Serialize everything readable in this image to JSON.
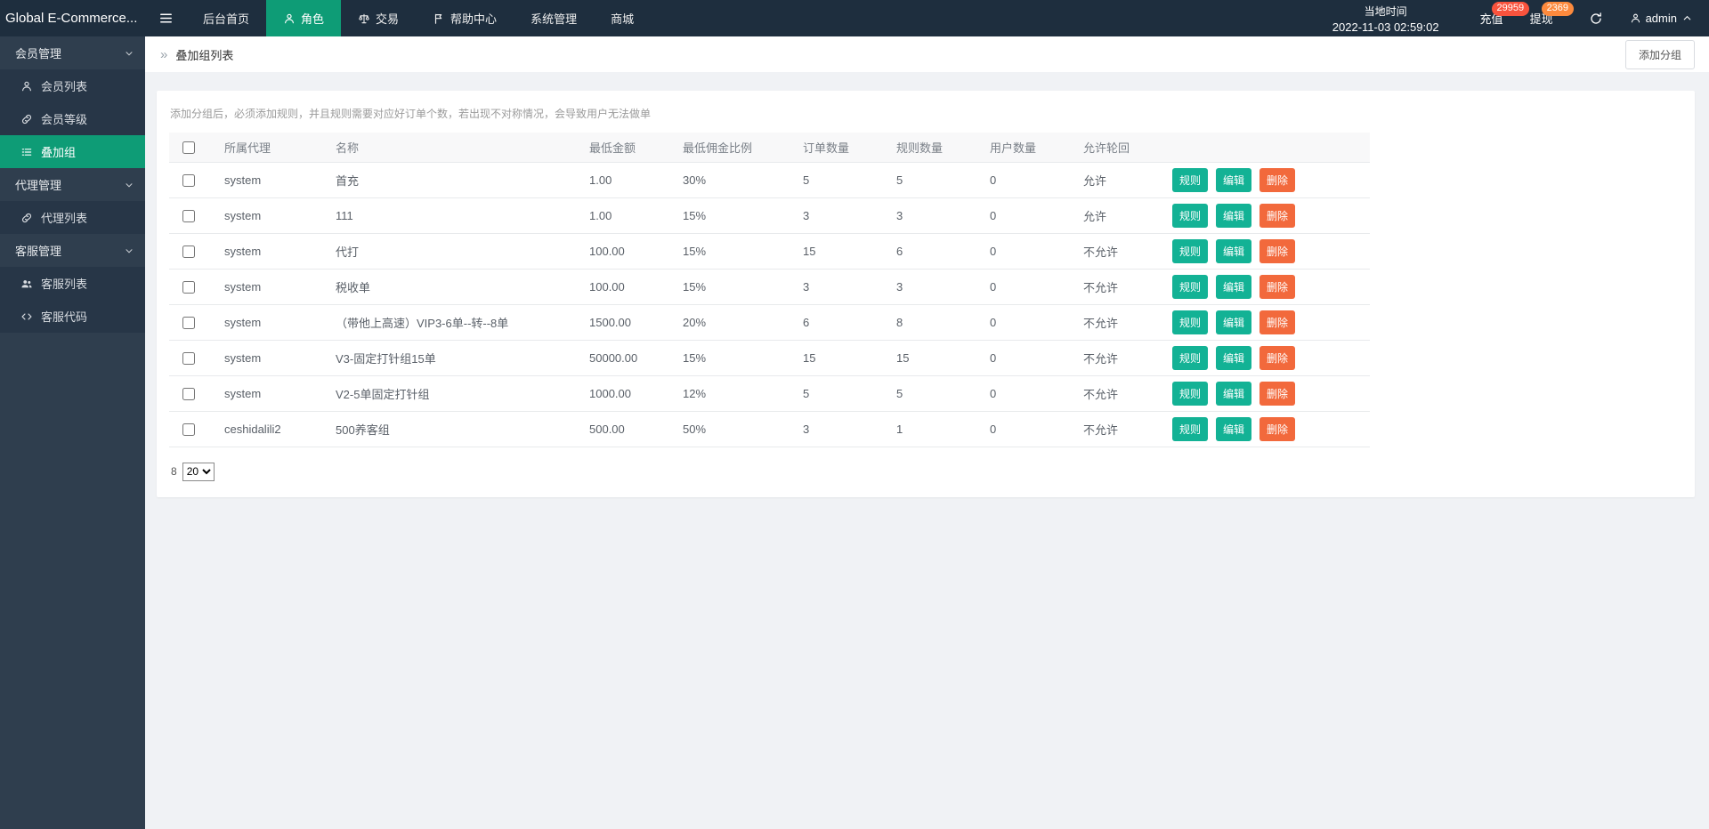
{
  "colors": {
    "topbar_bg": "#1e2e3e",
    "sidebar_bg": "#2f3e4e",
    "sidebar_item_bg": "#273647",
    "accent": "#0e9c76",
    "button_teal": "#13b295",
    "button_orange": "#f2693c",
    "badge_recharge": "#f9533d",
    "badge_withdraw": "#fd8a3d",
    "main_bg": "#f0f2f5"
  },
  "topbar": {
    "logo": "Global E-Commerce...",
    "nav": [
      {
        "label": "后台首页",
        "active": false
      },
      {
        "label": "角色",
        "icon": "person",
        "active": true
      },
      {
        "label": "交易",
        "icon": "scale",
        "active": false
      },
      {
        "label": "帮助中心",
        "icon": "flag",
        "active": false
      },
      {
        "label": "系统管理",
        "active": false
      },
      {
        "label": "商城",
        "active": false
      }
    ],
    "local_time_label": "当地时间",
    "local_time_value": "2022-11-03 02:59:02",
    "recharge_label": "充值",
    "recharge_badge": "29959",
    "withdraw_label": "提现",
    "withdraw_badge": "2369",
    "user": "admin"
  },
  "sidebar": {
    "items": [
      {
        "label": "会员管理",
        "type": "group"
      },
      {
        "label": "会员列表",
        "type": "item",
        "icon": "person"
      },
      {
        "label": "会员等级",
        "type": "item",
        "icon": "link"
      },
      {
        "label": "叠加组",
        "type": "item",
        "icon": "list",
        "active": true
      },
      {
        "label": "代理管理",
        "type": "group"
      },
      {
        "label": "代理列表",
        "type": "item",
        "icon": "link"
      },
      {
        "label": "客服管理",
        "type": "group"
      },
      {
        "label": "客服列表",
        "type": "item",
        "icon": "people"
      },
      {
        "label": "客服代码",
        "type": "item",
        "icon": "code"
      }
    ]
  },
  "page": {
    "breadcrumb_glyph": "»",
    "title": "叠加组列表",
    "add_button": "添加分组",
    "tip": "添加分组后，必须添加规则，并且规则需要对应好订单个数，若出现不对称情况，会导致用户无法做单",
    "pager": {
      "total": "8",
      "size": "20"
    }
  },
  "table": {
    "columns": [
      "所属代理",
      "名称",
      "最低金额",
      "最低佣金比例",
      "订单数量",
      "规则数量",
      "用户数量",
      "允许轮回"
    ],
    "actions": [
      "规则",
      "编辑",
      "删除"
    ],
    "rows": [
      {
        "cells": [
          "system",
          "首充",
          "1.00",
          "30%",
          "5",
          "5",
          "0",
          "允许"
        ]
      },
      {
        "cells": [
          "system",
          "111",
          "1.00",
          "15%",
          "3",
          "3",
          "0",
          "允许"
        ]
      },
      {
        "cells": [
          "system",
          "代打",
          "100.00",
          "15%",
          "15",
          "6",
          "0",
          "不允许"
        ]
      },
      {
        "cells": [
          "system",
          "税收单",
          "100.00",
          "15%",
          "3",
          "3",
          "0",
          "不允许"
        ]
      },
      {
        "cells": [
          "（带他上高速）VIP3-6单--转--8单",
          "",
          "",
          "",
          "",
          "",
          "",
          ""
        ],
        "note": "placeholder"
      },
      {
        "cells": [
          "system",
          "V3-固定打针组15单",
          "50000.00",
          "15%",
          "15",
          "15",
          "0",
          "不允许"
        ]
      },
      {
        "cells": [
          "system",
          "V2-5单固定打针组",
          "1000.00",
          "12%",
          "5",
          "5",
          "0",
          "不允许"
        ]
      },
      {
        "cells": [
          "ceshidalili2",
          "500养客组",
          "500.00",
          "50%",
          "3",
          "1",
          "0",
          "不允许"
        ]
      }
    ]
  }
}
